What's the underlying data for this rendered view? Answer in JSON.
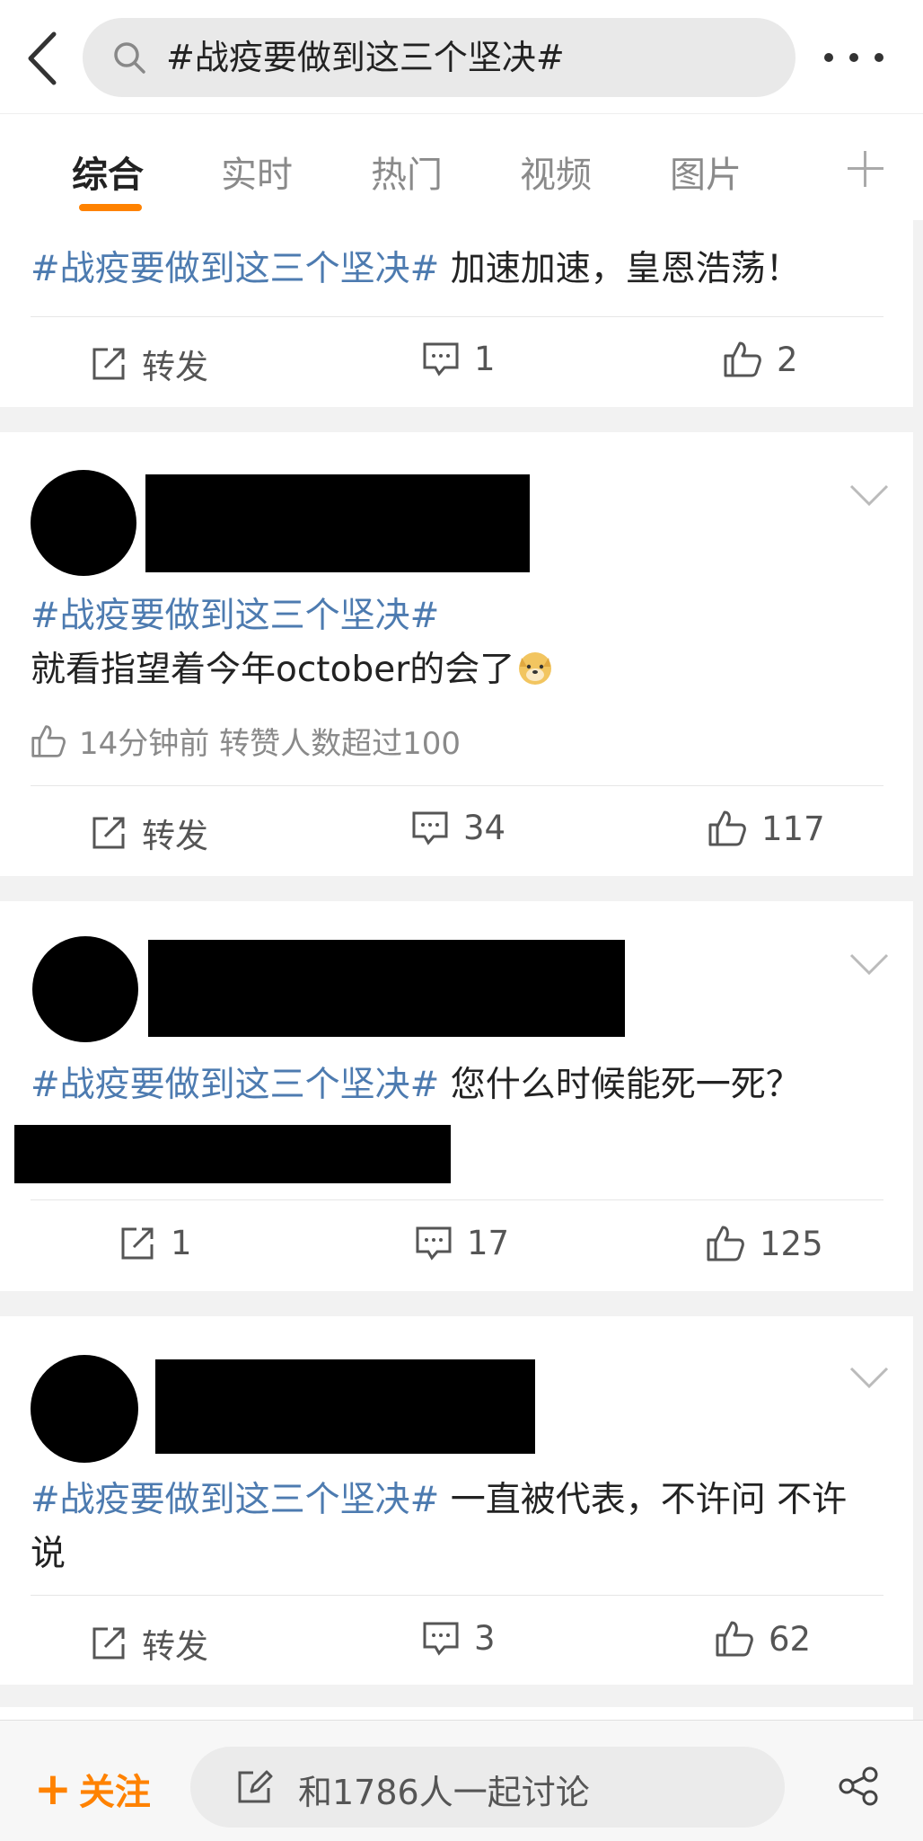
{
  "search": {
    "query": "#战疫要做到这三个坚决#"
  },
  "tabs": [
    {
      "label": "综合",
      "active": true
    },
    {
      "label": "实时"
    },
    {
      "label": "热门"
    },
    {
      "label": "视频"
    },
    {
      "label": "图片"
    }
  ],
  "posts": [
    {
      "topic": "#战疫要做到这三个坚决#",
      "body": " 加速加速，皇恩浩荡！",
      "repost_label": "转发",
      "comments": "1",
      "likes": "2"
    },
    {
      "topic": "#战疫要做到这三个坚决#",
      "body": "就看指望着今年october的会了",
      "meta": "14分钟前 转赞人数超过100",
      "repost_label": "转发",
      "comments": "34",
      "likes": "117"
    },
    {
      "topic": "#战疫要做到这三个坚决#",
      "body": " 您什么时候能死一死？",
      "reposts": "1",
      "comments": "17",
      "likes": "125"
    },
    {
      "topic": "#战疫要做到这三个坚决#",
      "body": " 一直被代表，不许问 不许说",
      "repost_label": "转发",
      "comments": "3",
      "likes": "62"
    }
  ],
  "bottom": {
    "follow_label": "关注",
    "discuss_placeholder": "和1786人一起讨论"
  },
  "colors": {
    "accent": "#ff8200",
    "topic": "#4d7bb0",
    "redaction": "#000000"
  }
}
